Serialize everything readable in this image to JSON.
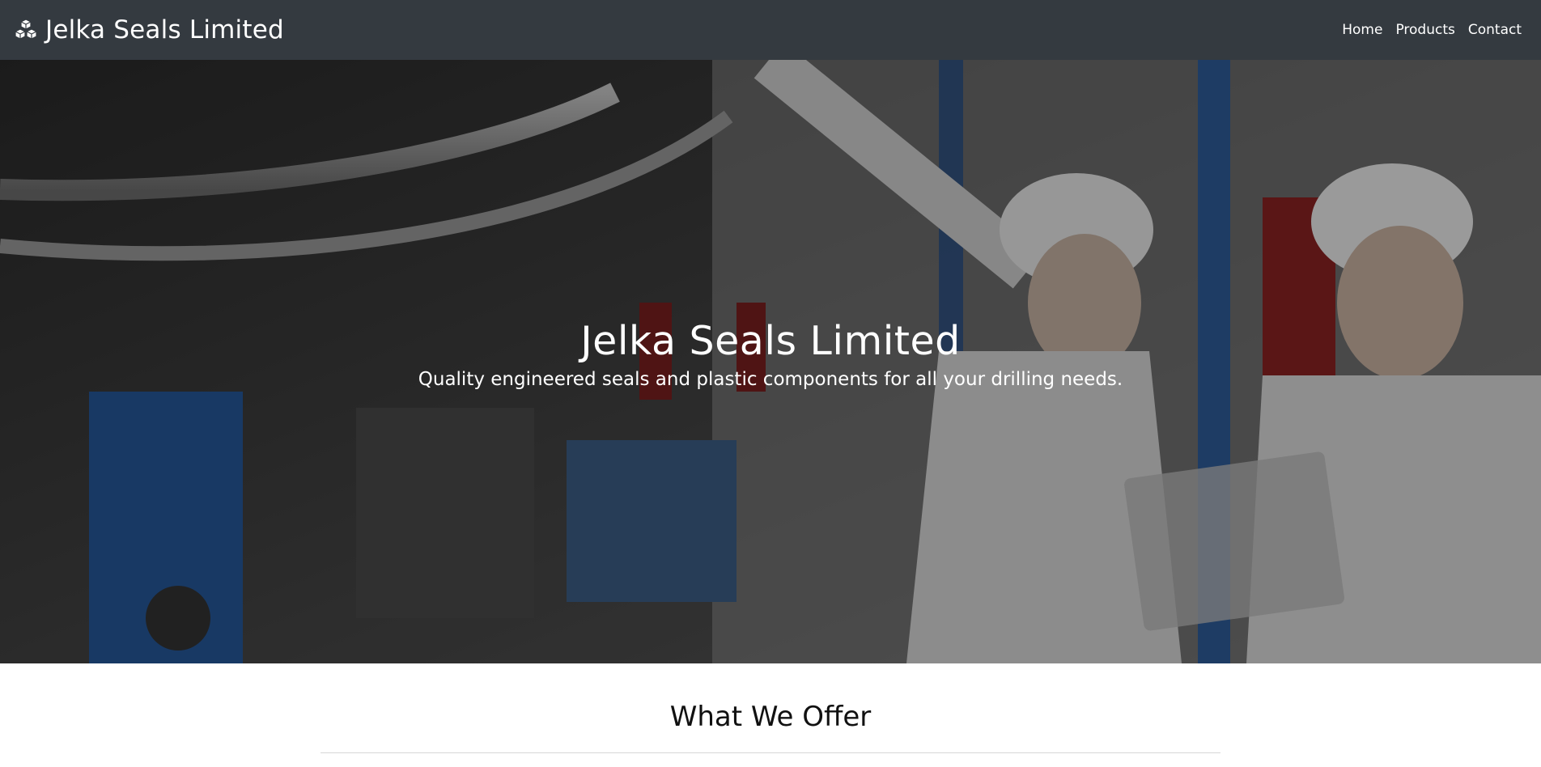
{
  "brand": {
    "name": "Jelka Seals Limited",
    "icon": "cubes-icon"
  },
  "nav": {
    "items": [
      {
        "label": "Home"
      },
      {
        "label": "Products"
      },
      {
        "label": "Contact"
      }
    ]
  },
  "hero": {
    "title": "Jelka Seals Limited",
    "subtitle": "Quality engineered seals and plastic components for all your drilling needs."
  },
  "section": {
    "heading": "What We Offer"
  },
  "colors": {
    "navbar_bg": "#343a40",
    "nav_text": "#ffffff",
    "hero_text": "#ffffff"
  }
}
